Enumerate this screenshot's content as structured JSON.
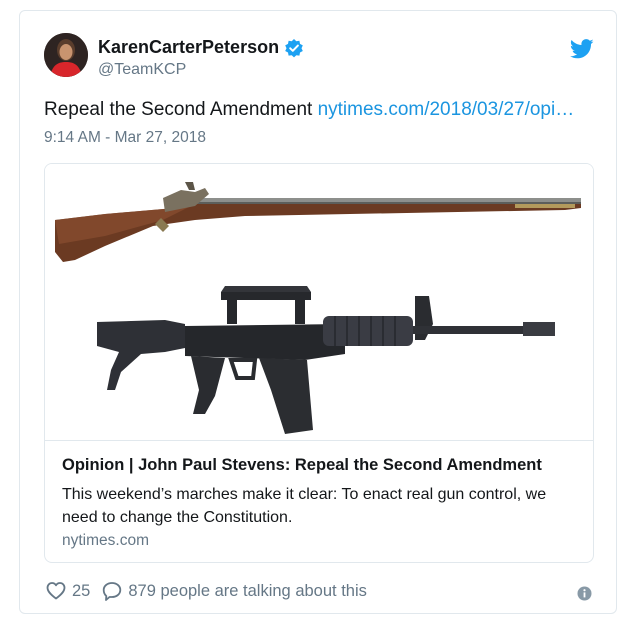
{
  "author": {
    "display_name": "KarenCarterPeterson",
    "handle": "@TeamKCP",
    "verified": true
  },
  "tweet": {
    "text": "Repeal the Second Amendment ",
    "link_text": "nytimes.com/2018/03/27/opi…",
    "timestamp": "9:14 AM - Mar 27, 2018"
  },
  "card": {
    "title": "Opinion | John Paul Stevens: Repeal the Second Amendment",
    "description": "This weekend’s marches make it clear: To enact real gun control, we need to change the Constitution.",
    "domain": "nytimes.com"
  },
  "actions": {
    "likes": "25",
    "conversation": "879 people are talking about this"
  },
  "icons": {
    "logo": "twitter-bird-icon",
    "verified": "verified-badge-icon",
    "like": "heart-icon",
    "reply": "speech-bubble-icon",
    "info": "info-icon"
  },
  "colors": {
    "link": "#1b95e0",
    "muted": "#657786",
    "verified": "#1da1f2",
    "border": "#e1e8ed"
  }
}
